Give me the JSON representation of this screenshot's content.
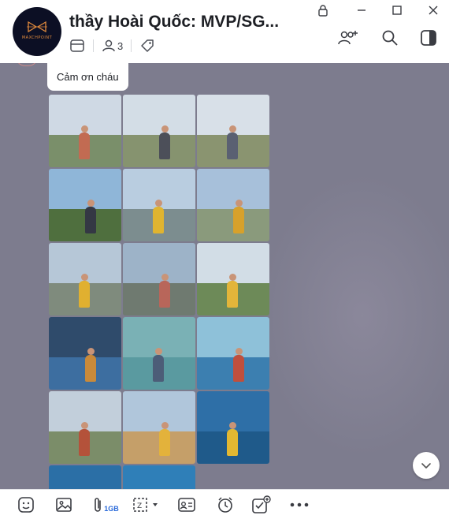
{
  "header": {
    "title": "thầy Hoài Quốc: MVP/SG...",
    "avatar_logo_text": "MAXCHPOINT",
    "member_count": "3"
  },
  "chat": {
    "message_text": "Cảm ơn cháu",
    "photos": [
      {
        "sky": "#cfd9e4",
        "ground": "#7a8f6a",
        "fig": "#c26b52"
      },
      {
        "sky": "#d3dde6",
        "ground": "#86936f",
        "fig": "#4c4f59"
      },
      {
        "sky": "#d8e0e8",
        "ground": "#8a9470",
        "fig": "#5a6072"
      },
      {
        "sky": "#8fb6d8",
        "ground": "#4f6f3e",
        "fig": "#343844"
      },
      {
        "sky": "#b9cde0",
        "ground": "#7c8d8f",
        "fig": "#e0b430"
      },
      {
        "sky": "#a7c0da",
        "ground": "#8a9a7c",
        "fig": "#d7a12b"
      },
      {
        "sky": "#b6c7d7",
        "ground": "#7f8b7d",
        "fig": "#e0b030"
      },
      {
        "sky": "#9db3c8",
        "ground": "#6f7a70",
        "fig": "#b8665a"
      },
      {
        "sky": "#d2dde6",
        "ground": "#6d8a58",
        "fig": "#e3b53a"
      },
      {
        "sky": "#2f4b6b",
        "ground": "#3d6ea0",
        "fig": "#c98a3a"
      },
      {
        "sky": "#7ab1b5",
        "ground": "#5a9aa0",
        "fig": "#4c5d78"
      },
      {
        "sky": "#8ec1d9",
        "ground": "#3c7fb0",
        "fig": "#c04f3c"
      },
      {
        "sky": "#c2cfdb",
        "ground": "#7b8d69",
        "fig": "#b4523a"
      },
      {
        "sky": "#b0c6db",
        "ground": "#c59f69",
        "fig": "#e3b23b"
      },
      {
        "sky": "#2e6fa7",
        "ground": "#1f5a8a",
        "fig": "#e2b832"
      },
      {
        "sky": "#2b6fa6",
        "ground": "#1b5e92",
        "fig": "#3b3f4c"
      },
      {
        "sky": "#2f7fb8",
        "ground": "#2a6fa2",
        "fig": "#3b3f4c"
      }
    ]
  },
  "toolbar": {
    "file_size_badge": "1GB"
  },
  "colors": {
    "chat_background": "#7d7c8e",
    "accent": "#2a6ad9"
  }
}
